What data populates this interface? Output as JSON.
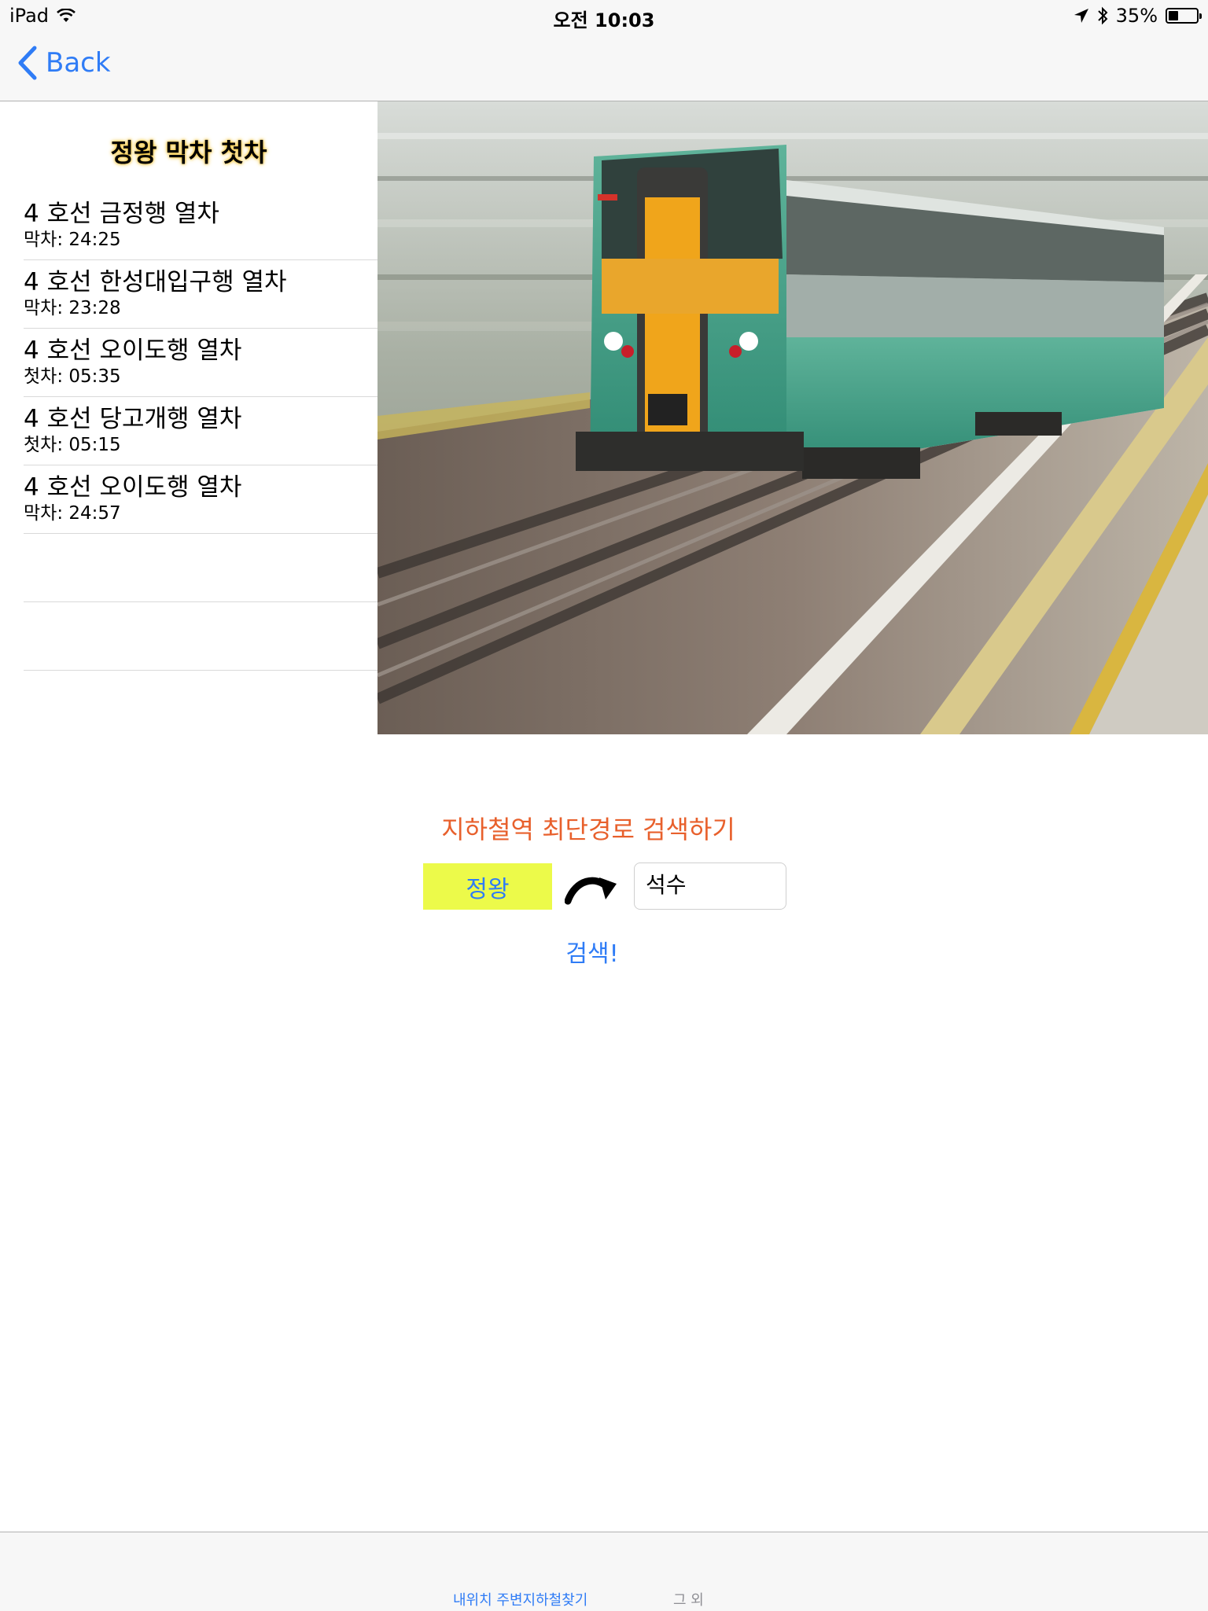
{
  "status_bar": {
    "device": "iPad",
    "time": "오전 10:03",
    "battery_percent": "35%",
    "battery_level": 0.35
  },
  "nav": {
    "back_label": "Back"
  },
  "list": {
    "title": "정왕 막차 첫차",
    "items": [
      {
        "title": "4 호선 금정행 열차",
        "detail": "막차: 24:25"
      },
      {
        "title": "4 호선 한성대입구행 열차",
        "detail": "막차: 23:28"
      },
      {
        "title": "4 호선 오이도행 열차",
        "detail": "첫차: 05:35"
      },
      {
        "title": "4 호선 당고개행 열차",
        "detail": "첫차: 05:15"
      },
      {
        "title": "4 호선 오이도행 열차",
        "detail": "막차: 24:57"
      }
    ]
  },
  "search": {
    "title": "지하철역 최단경로 검색하기",
    "from_value": "정왕",
    "to_value": "석수",
    "button_label": "검색!"
  },
  "tabs": [
    {
      "label": "내위치 주변지하철찾기",
      "active": true
    },
    {
      "label": "그 외",
      "active": false
    }
  ],
  "colors": {
    "accent": "#2f7cf6",
    "search_title": "#e8602c",
    "from_field_bg": "#ecfa4a"
  }
}
